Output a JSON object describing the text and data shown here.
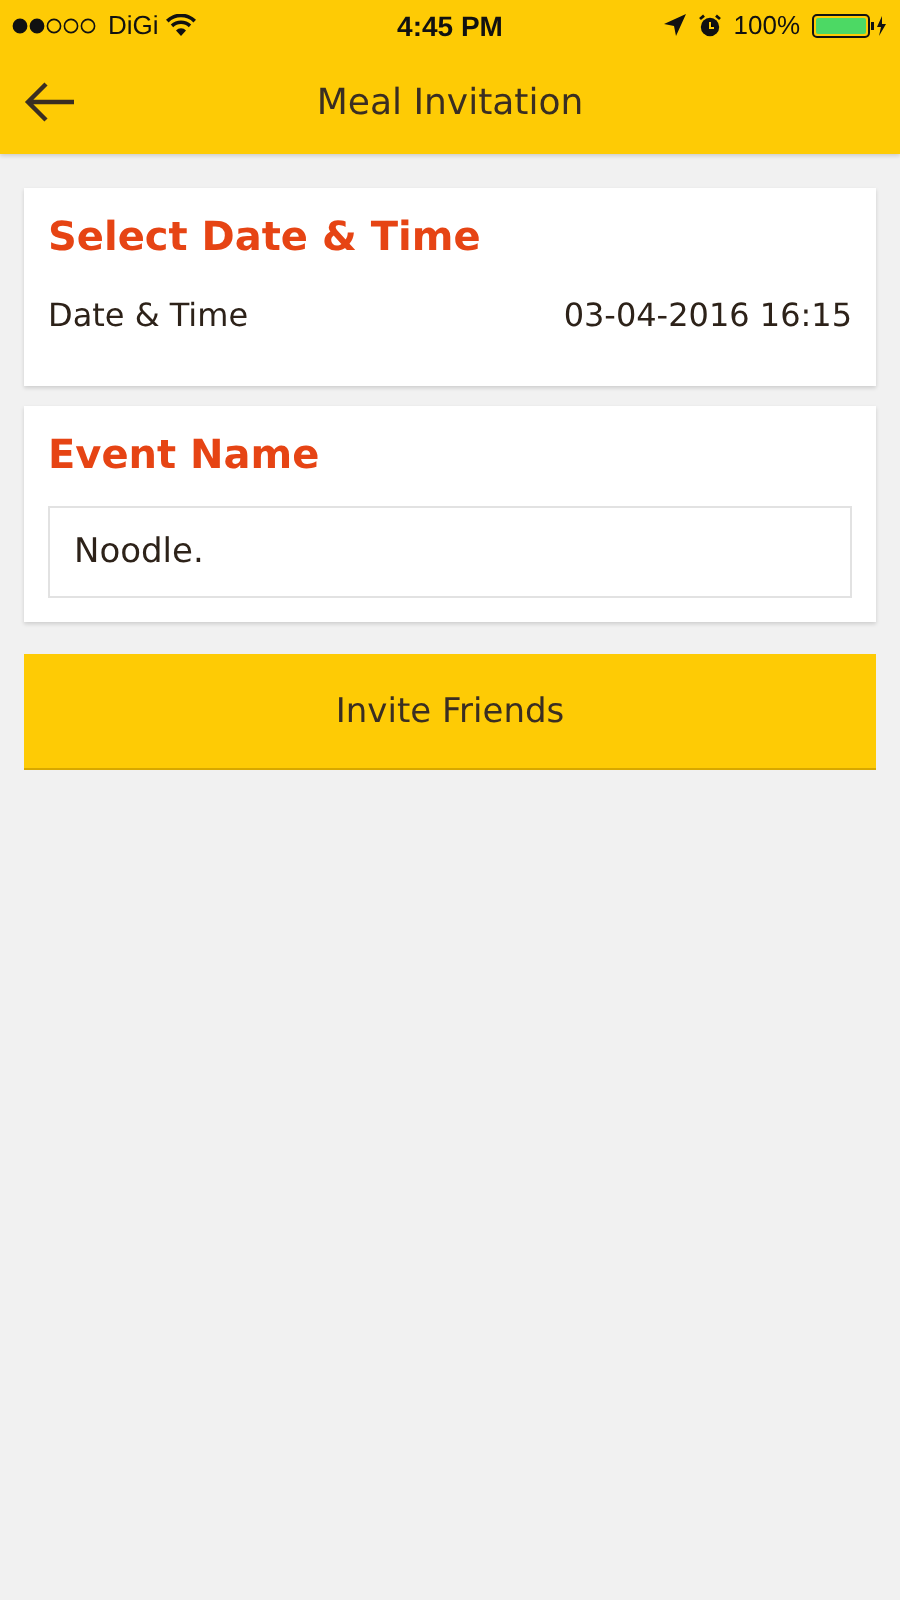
{
  "status_bar": {
    "carrier": "DiGi",
    "time": "4:45 PM",
    "battery": "100%"
  },
  "nav": {
    "title": "Meal Invitation"
  },
  "date_card": {
    "heading": "Select Date & Time",
    "label": "Date & Time",
    "value": "03-04-2016 16:15"
  },
  "event_card": {
    "heading": "Event Name",
    "value": "Noodle."
  },
  "button": "Invite Friends"
}
